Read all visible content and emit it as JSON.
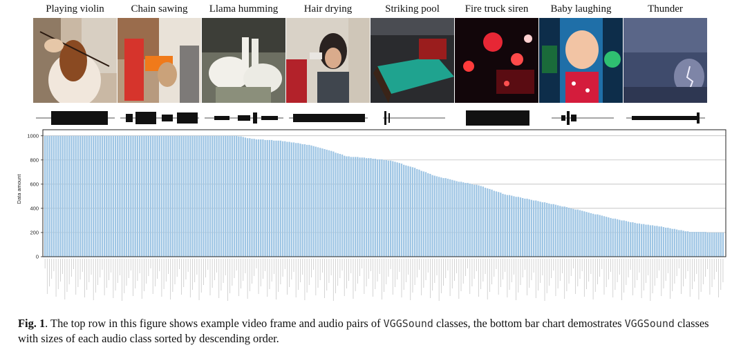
{
  "examples": [
    {
      "label": "Playing violin"
    },
    {
      "label": "Chain sawing"
    },
    {
      "label": "Llama humming"
    },
    {
      "label": "Hair drying"
    },
    {
      "label": "Striking pool"
    },
    {
      "label": "Fire truck siren"
    },
    {
      "label": "Baby laughing"
    },
    {
      "label": "Thunder"
    }
  ],
  "chart_data": {
    "type": "bar",
    "title": "",
    "xlabel": "",
    "ylabel": "Data amount",
    "ylim": [
      0,
      1050
    ],
    "yticks": [
      0,
      200,
      400,
      600,
      800,
      1000
    ],
    "grid": "horizontal",
    "bar_color": "#9ec5e4",
    "category_count": 309,
    "values_profile": [
      {
        "rank": 1,
        "value": 1000
      },
      {
        "rank": 88,
        "value": 1000
      },
      {
        "rank": 95,
        "value": 975
      },
      {
        "rank": 110,
        "value": 955
      },
      {
        "rank": 122,
        "value": 920
      },
      {
        "rank": 130,
        "value": 880
      },
      {
        "rank": 138,
        "value": 830
      },
      {
        "rank": 148,
        "value": 815
      },
      {
        "rank": 158,
        "value": 795
      },
      {
        "rank": 168,
        "value": 740
      },
      {
        "rank": 178,
        "value": 670
      },
      {
        "rank": 188,
        "value": 625
      },
      {
        "rank": 198,
        "value": 590
      },
      {
        "rank": 210,
        "value": 515
      },
      {
        "rank": 222,
        "value": 470
      },
      {
        "rank": 234,
        "value": 425
      },
      {
        "rank": 246,
        "value": 375
      },
      {
        "rank": 258,
        "value": 320
      },
      {
        "rank": 270,
        "value": 275
      },
      {
        "rank": 282,
        "value": 245
      },
      {
        "rank": 294,
        "value": 205
      },
      {
        "rank": 309,
        "value": 200
      }
    ]
  },
  "caption": {
    "fig_label": "Fig. 1",
    "text_1": ". The top row in this figure shows example video frame and audio pairs of ",
    "dataset_1": "VGGSound",
    "text_2": " classes, the bottom bar chart demostrates ",
    "dataset_2": "VGGSound",
    "text_3": " classes with sizes of each audio class sorted by descending order."
  }
}
